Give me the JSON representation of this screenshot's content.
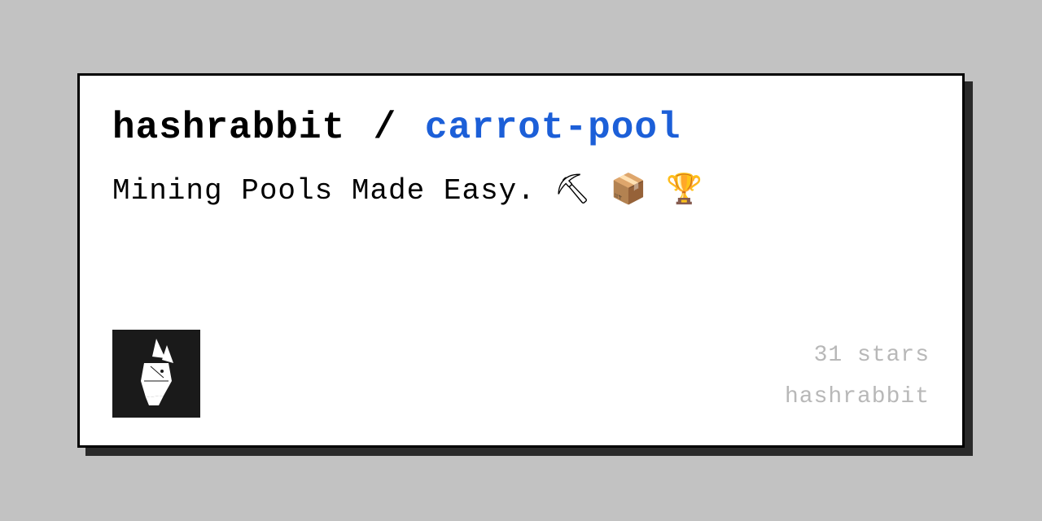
{
  "card": {
    "owner": "hashrabbit",
    "separator": "/",
    "repo": "carrot-pool",
    "description": "Mining Pools Made Easy. ⛏ 📦 🏆"
  },
  "footer": {
    "stars": "31 stars",
    "username": "hashrabbit"
  }
}
